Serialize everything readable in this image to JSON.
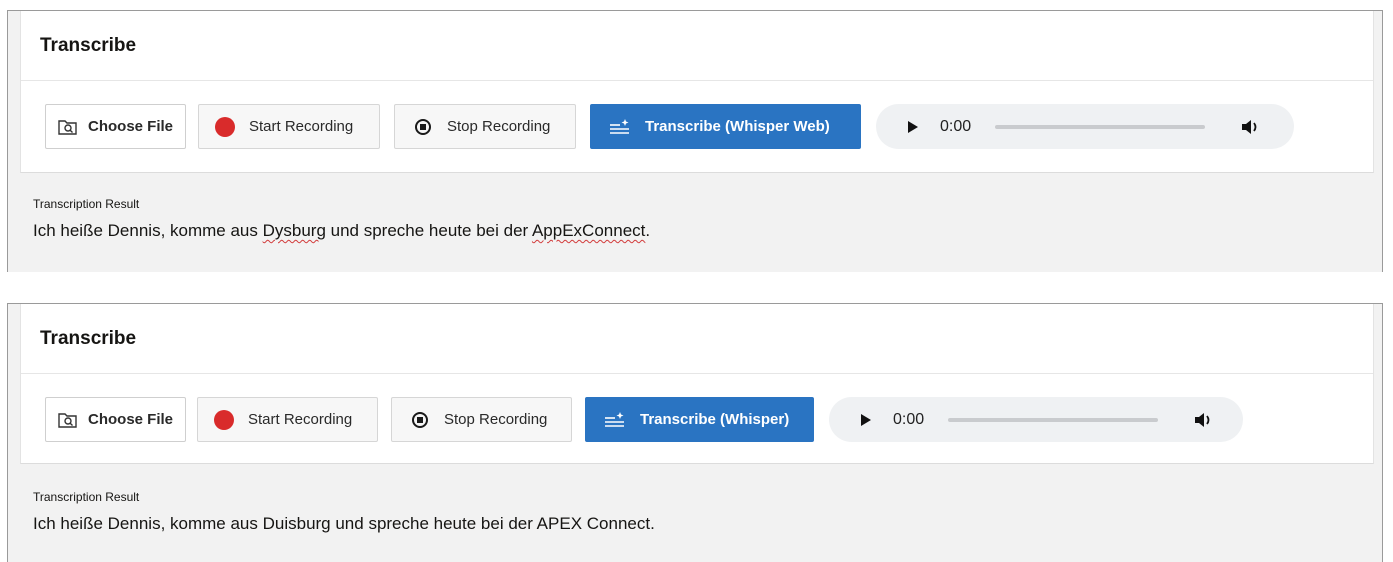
{
  "panels": [
    {
      "title": "Transcribe",
      "choose_file_label": "Choose File",
      "start_recording_label": "Start Recording",
      "stop_recording_label": "Stop Recording",
      "transcribe_label": "Transcribe (Whisper Web)",
      "audio_time": "0:00",
      "result_label": "Transcription Result",
      "result_segments": [
        "Ich heiße Dennis, komme aus ",
        "Dysburg",
        " und spreche heute bei der ",
        "AppExConnect",
        "."
      ]
    },
    {
      "title": "Transcribe",
      "choose_file_label": "Choose File",
      "start_recording_label": "Start Recording",
      "stop_recording_label": "Stop Recording",
      "transcribe_label": "Transcribe (Whisper)",
      "audio_time": "0:00",
      "result_label": "Transcription Result",
      "result_text": "Ich heiße Dennis, komme aus Duisburg und spreche heute bei der APEX Connect."
    }
  ],
  "icons": {
    "choose_file": "folder-search-icon",
    "start_recording": "record-dot-icon",
    "stop_recording": "stop-circle-icon",
    "transcribe": "transcribe-lines-icon",
    "play": "play-icon",
    "volume": "volume-icon"
  },
  "colors": {
    "primary": "#2a74c2",
    "record": "#d92b2b",
    "spellcheck": "#d23b3b"
  },
  "audio_progress": 0
}
